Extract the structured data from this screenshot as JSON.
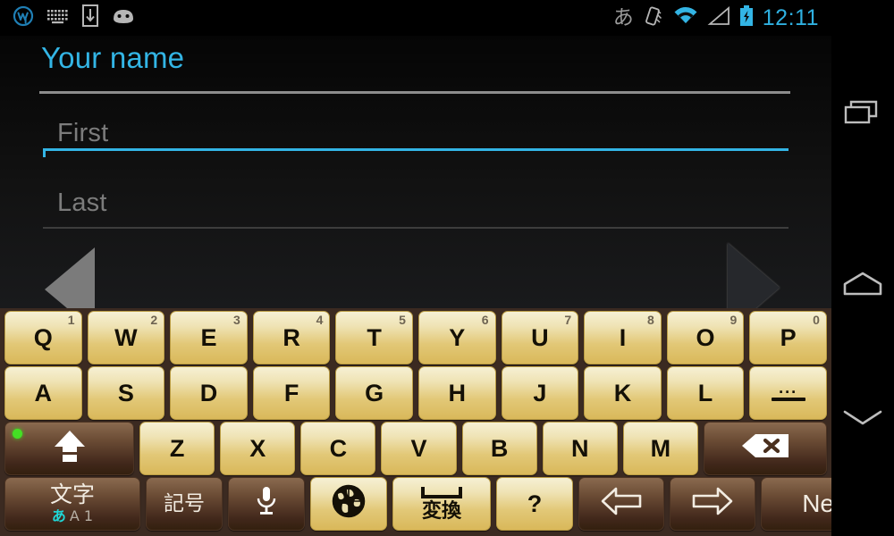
{
  "statusbar": {
    "left_icons": [
      {
        "name": "wordpress-logo-icon",
        "label": "W"
      },
      {
        "name": "keyboard-icon",
        "label": "keyboard"
      },
      {
        "name": "download-to-device-icon",
        "label": "download"
      },
      {
        "name": "android-face-icon",
        "label": "android"
      }
    ],
    "ime_indicator": "あ",
    "right_icons": [
      {
        "name": "vibrate-icon",
        "label": "vibrate"
      },
      {
        "name": "wifi-icon",
        "label": "wifi"
      },
      {
        "name": "signal-icon",
        "label": "signal"
      },
      {
        "name": "battery-charging-icon",
        "label": "battery charging"
      }
    ],
    "clock": "12:11",
    "clock_color": "#33b5e5"
  },
  "content": {
    "page_title": "Your name",
    "title_color": "#33b5e5",
    "fields": [
      {
        "name": "first-name-field",
        "placeholder": "First",
        "value": "",
        "focused": true
      },
      {
        "name": "last-name-field",
        "placeholder": "Last",
        "value": "",
        "focused": false
      }
    ],
    "prev_button": "previous-page-arrow",
    "next_button": "next-page-arrow"
  },
  "keyboard": {
    "background": "#3b2a21",
    "rows": [
      {
        "name": "row-qwerty",
        "keys": [
          {
            "label": "Q",
            "sup": "1",
            "style": "gold"
          },
          {
            "label": "W",
            "sup": "2",
            "style": "gold"
          },
          {
            "label": "E",
            "sup": "3",
            "style": "gold"
          },
          {
            "label": "R",
            "sup": "4",
            "style": "gold"
          },
          {
            "label": "T",
            "sup": "5",
            "style": "gold"
          },
          {
            "label": "Y",
            "sup": "6",
            "style": "gold"
          },
          {
            "label": "U",
            "sup": "7",
            "style": "gold"
          },
          {
            "label": "I",
            "sup": "8",
            "style": "gold"
          },
          {
            "label": "O",
            "sup": "9",
            "style": "gold"
          },
          {
            "label": "P",
            "sup": "0",
            "style": "gold"
          }
        ]
      },
      {
        "name": "row-asdf",
        "keys": [
          {
            "label": "A",
            "style": "gold"
          },
          {
            "label": "S",
            "style": "gold"
          },
          {
            "label": "D",
            "style": "gold"
          },
          {
            "label": "F",
            "style": "gold"
          },
          {
            "label": "G",
            "style": "gold"
          },
          {
            "label": "H",
            "style": "gold"
          },
          {
            "label": "J",
            "style": "gold"
          },
          {
            "label": "K",
            "style": "gold"
          },
          {
            "label": "L",
            "style": "gold"
          },
          {
            "label": "dash",
            "dots": "...",
            "style": "gold"
          }
        ]
      },
      {
        "name": "row-zxcv",
        "keys": [
          {
            "label": "shift",
            "style": "brown",
            "led": true
          },
          {
            "label": "Z",
            "style": "gold"
          },
          {
            "label": "X",
            "style": "gold"
          },
          {
            "label": "C",
            "style": "gold"
          },
          {
            "label": "V",
            "style": "gold"
          },
          {
            "label": "B",
            "style": "gold"
          },
          {
            "label": "N",
            "style": "gold"
          },
          {
            "label": "M",
            "style": "gold"
          },
          {
            "label": "backspace",
            "style": "brown"
          }
        ]
      },
      {
        "name": "row-bottom",
        "keys": [
          {
            "label": "文字",
            "sub_kana": "あ",
            "sub_rom": "A 1",
            "style": "brown"
          },
          {
            "label": "記号",
            "style": "brown"
          },
          {
            "label": "mic",
            "style": "brown"
          },
          {
            "label": "globe",
            "style": "gold"
          },
          {
            "label": "変換",
            "style": "gold"
          },
          {
            "label": "?",
            "style": "gold"
          },
          {
            "label": "arrow-left",
            "style": "brown"
          },
          {
            "label": "arrow-right",
            "style": "brown"
          },
          {
            "label": "Next",
            "style": "brown"
          }
        ]
      }
    ]
  },
  "navbar": {
    "items": [
      {
        "name": "recents-button",
        "label": "recents"
      },
      {
        "name": "home-button",
        "label": "home"
      },
      {
        "name": "hide-keyboard-button",
        "label": "hide keyboard"
      }
    ]
  }
}
